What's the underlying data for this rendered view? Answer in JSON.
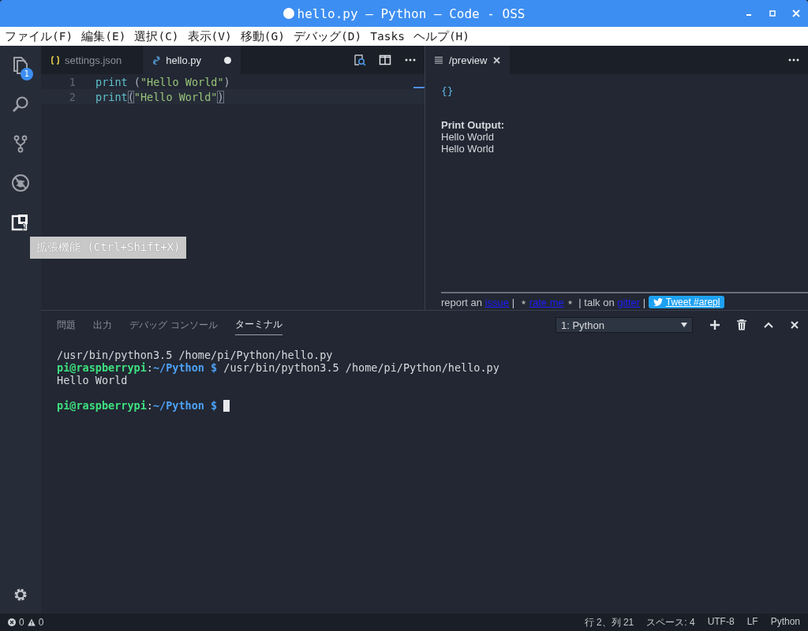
{
  "window": {
    "title": "hello.py — Python — Code - OSS",
    "dirty": true
  },
  "menu": [
    "ファイル(F)",
    "編集(E)",
    "選択(C)",
    "表示(V)",
    "移動(G)",
    "デバッグ(D)",
    "Tasks",
    "ヘルプ(H)"
  ],
  "activity_bar": [
    {
      "kind": "files",
      "badge": "1",
      "hovered": false
    },
    {
      "kind": "search",
      "hovered": false
    },
    {
      "kind": "branch",
      "hovered": false
    },
    {
      "kind": "bug",
      "hovered": false
    },
    {
      "kind": "extensions",
      "hovered": true
    }
  ],
  "tooltip": "拡張機能 (Ctrl+Shift+X)",
  "editor_tabs": [
    {
      "label": "settings.json",
      "kind": "json",
      "selected": false,
      "dirty": false
    },
    {
      "label": "hello.py",
      "kind": "python",
      "selected": true,
      "dirty": true
    }
  ],
  "code_lines": [
    {
      "number": "1",
      "current": false,
      "tokens": [
        {
          "kind": "func",
          "text": "print",
          "matched": false
        },
        {
          "kind": "punct",
          "text": " (",
          "matched": false
        },
        {
          "kind": "string",
          "text": "\"Hello World\"",
          "matched": false
        },
        {
          "kind": "punct",
          "text": ")",
          "matched": false
        }
      ]
    },
    {
      "number": "2",
      "current": true,
      "tokens": [
        {
          "kind": "func",
          "text": "print",
          "matched": false
        },
        {
          "kind": "punct",
          "text": "(",
          "matched": true
        },
        {
          "kind": "string",
          "text": "\"Hello World\"",
          "matched": false
        },
        {
          "kind": "punct",
          "text": ")",
          "matched": true
        }
      ]
    }
  ],
  "preview": {
    "tab": "/preview",
    "braces": "{}",
    "heading": "Print Output:",
    "output": [
      "Hello World",
      "Hello World"
    ],
    "footer": [
      {
        "kind": "text",
        "text": "report an "
      },
      {
        "kind": "link",
        "text": "issue"
      },
      {
        "kind": "text",
        "text": " | "
      },
      {
        "kind": "star",
        "text": "★"
      },
      {
        "kind": "link",
        "text": "rate me"
      },
      {
        "kind": "star",
        "text": "★"
      },
      {
        "kind": "text",
        "text": " | talk on "
      },
      {
        "kind": "link",
        "text": "gitter"
      },
      {
        "kind": "text",
        "text": " | "
      },
      {
        "kind": "button",
        "text": "Tweet #arepl"
      }
    ]
  },
  "panel": {
    "tabs": [
      {
        "label": "問題",
        "selected": false
      },
      {
        "label": "出力",
        "selected": false
      },
      {
        "label": "デバッグ コンソール",
        "selected": false
      },
      {
        "label": "ターミナル",
        "selected": true
      }
    ],
    "terminal_select": "1: Python",
    "terminal_lines": [
      {
        "segments": [
          {
            "kind": "plain",
            "text": "/usr/bin/python3.5 /home/pi/Python/hello.py"
          }
        ]
      },
      {
        "segments": [
          {
            "kind": "user",
            "text": "pi@raspberrypi"
          },
          {
            "kind": "plain",
            "text": ":"
          },
          {
            "kind": "path",
            "text": "~/Python $"
          },
          {
            "kind": "plain",
            "text": " /usr/bin/python3.5 /home/pi/Python/hello.py"
          }
        ]
      },
      {
        "segments": [
          {
            "kind": "plain",
            "text": "Hello World"
          }
        ]
      },
      {
        "blank_before": true,
        "cursor": true,
        "segments": [
          {
            "kind": "user",
            "text": "pi@raspberrypi"
          },
          {
            "kind": "plain",
            "text": ":"
          },
          {
            "kind": "path",
            "text": "~/Python $"
          }
        ]
      }
    ]
  },
  "status_bar": {
    "errors": "0",
    "warnings": "0",
    "items": [
      "行 2、列 21",
      "スペース: 4",
      "UTF-8",
      "LF",
      "Python"
    ]
  }
}
